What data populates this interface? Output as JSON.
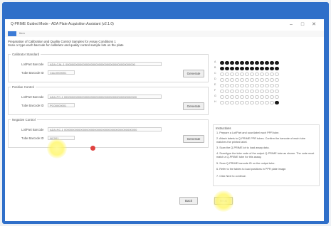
{
  "window": {
    "title": "Q-PRIME Guided Mode - ADA Plate Acquisition Assistant (v2.1.0)",
    "minimize": "–",
    "maximize": "□",
    "close": "✕"
  },
  "menubar": {
    "label": "Item"
  },
  "instruction": {
    "line1": "Preparation of Calibration and Quality Control Samples for Assay Conditions 1",
    "line2": "Scan or type each barcode for calibrator and quality control sample lots on the plate"
  },
  "groups": [
    {
      "title": "Calibrator Standard",
      "lot_label": "Lot/Part Barcode",
      "lot_value": "ADA-CAL-1 00000000000000000000000000000000000000000000",
      "tube_label": "Tube Barcode ID",
      "tube_value": "CAL0000001",
      "button": "Generate"
    },
    {
      "title": "Positive Control",
      "lot_label": "Lot/Part Barcode",
      "lot_value": "ADA-PC-1 0000000000000000000000000000000000000000000000",
      "tube_label": "Tube Barcode ID",
      "tube_value": "PC00000001",
      "button": "Generate"
    },
    {
      "title": "Negative Control",
      "lot_label": "Lot/Part Barcode",
      "lot_value": "ADA-NC-1 0000000000000000000000000000000000000000000000",
      "tube_label": "Tube Barcode ID",
      "tube_value": "NC001",
      "button": "Generate"
    }
  ],
  "plate": {
    "rows": [
      "A",
      "B",
      "C",
      "D",
      "E",
      "F",
      "G",
      "H"
    ],
    "columns": 12,
    "filled_rows": 2,
    "last_row_filled_wells": 1
  },
  "notes": {
    "title": "Instructions",
    "items": [
      "1. Prepare a Lot/Part and scan/label each PPR tube.",
      "2. Attach labels to Q-PRIME PPR tubes. Confirm the barcode of each tube matches the printed label.",
      "3. Scan the Q-PRIME lot to load assay data.",
      "4. Scan/type the tube code of the output Q-PRIME tube as shown. The code must match a Q-PRIME tube for this assay.",
      "5. Scan Q-PRIME barcode ID on the output tube.",
      "6. Refer to the tables to load positions in PPR plate image.",
      "7. Click Next to continue."
    ]
  },
  "footer": {
    "back": "Back",
    "next": "Next"
  },
  "colors": {
    "frame": "#2f6fc9",
    "filled_well": "#1a1a1a",
    "error_marker": "#e0413f",
    "highlight": "#fff45a"
  }
}
